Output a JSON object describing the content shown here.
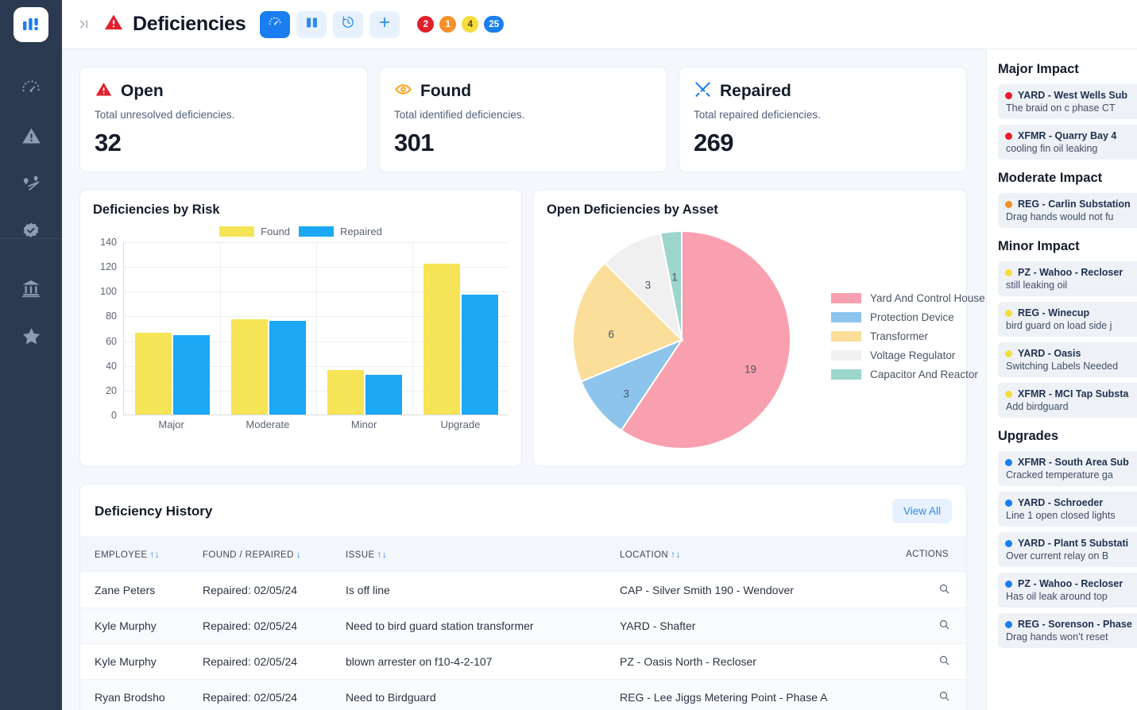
{
  "rail": {
    "logo": "app-logo",
    "items": [
      {
        "icon": "gauge-icon",
        "name": "dashboard"
      },
      {
        "icon": "warning-triangle-icon",
        "name": "deficiencies"
      },
      {
        "icon": "map-pin-route-icon",
        "name": "routes"
      },
      {
        "icon": "badge-check-icon",
        "name": "inspections"
      },
      {
        "icon": "bank-icon",
        "name": "substations"
      },
      {
        "icon": "star-icon",
        "name": "favorites"
      }
    ]
  },
  "topbar": {
    "collapse_label": "›|",
    "title": "Deficiencies",
    "title_icon": "warning-triangle-icon",
    "actions": [
      {
        "name": "dashboard-view",
        "icon": "gauge-icon",
        "active": true
      },
      {
        "name": "board-view",
        "icon": "columns-icon",
        "active": false
      },
      {
        "name": "history-view",
        "icon": "clock-rewind-icon",
        "active": false
      },
      {
        "name": "add-new",
        "icon": "plus-icon",
        "active": false
      }
    ],
    "badges": [
      {
        "value": "2",
        "color": "red"
      },
      {
        "value": "1",
        "color": "orange"
      },
      {
        "value": "4",
        "color": "yellow"
      },
      {
        "value": "25",
        "color": "blue"
      }
    ]
  },
  "stats": [
    {
      "icon": "warning-triangle-icon",
      "title": "Open",
      "subtitle": "Total unresolved deficiencies.",
      "value": "32"
    },
    {
      "icon": "eye-icon",
      "title": "Found",
      "subtitle": "Total identified deficiencies.",
      "value": "301"
    },
    {
      "icon": "tools-icon",
      "title": "Repaired",
      "subtitle": "Total repaired deficiencies.",
      "value": "269"
    }
  ],
  "chart_data": [
    {
      "type": "bar",
      "title": "Deficiencies by Risk",
      "categories": [
        "Major",
        "Moderate",
        "Minor",
        "Upgrade"
      ],
      "series": [
        {
          "name": "Found",
          "color": "#f5e455",
          "values": [
            66,
            77,
            36,
            122
          ]
        },
        {
          "name": "Repaired",
          "color": "#1ca8f5",
          "values": [
            64,
            76,
            32,
            97
          ]
        }
      ],
      "xlabel": "",
      "ylabel": "",
      "ylim": [
        0,
        140
      ],
      "yticks": [
        0,
        20,
        40,
        60,
        80,
        100,
        120,
        140
      ],
      "grid": true,
      "legend_position": "top"
    },
    {
      "type": "pie",
      "title": "Open Deficiencies by Asset",
      "labels": [
        "Yard And Control House",
        "Protection Device",
        "Transformer",
        "Voltage Regulator",
        "Capacitor And Reactor"
      ],
      "values": [
        19,
        3,
        6,
        3,
        1
      ],
      "colors": [
        "#f9a0b0",
        "#8cc4ec",
        "#fbde9a",
        "#f0f0f0",
        "#9bd5cc"
      ],
      "legend_position": "right"
    }
  ],
  "history": {
    "title": "Deficiency History",
    "view_all": "View All",
    "columns": [
      {
        "label": "EMPLOYEE",
        "sort": "both"
      },
      {
        "label": "FOUND / REPAIRED",
        "sort": "down"
      },
      {
        "label": "ISSUE",
        "sort": "both"
      },
      {
        "label": "LOCATION",
        "sort": "both"
      },
      {
        "label": "ACTIONS",
        "sort": "none"
      }
    ],
    "rows": [
      {
        "employee": "Zane Peters",
        "found_repaired": "Repaired: 02/05/24",
        "issue": "Is off line",
        "location": "CAP - Silver Smith 190 - Wendover",
        "action_icon": "search-icon"
      },
      {
        "employee": "Kyle Murphy",
        "found_repaired": "Repaired: 02/05/24",
        "issue": "Need to bird guard station transformer",
        "location": "YARD - Shafter",
        "action_icon": "search-icon"
      },
      {
        "employee": "Kyle Murphy",
        "found_repaired": "Repaired: 02/05/24",
        "issue": "blown arrester on f10-4-2-107",
        "location": "PZ - Oasis North - Recloser",
        "action_icon": "search-icon"
      },
      {
        "employee": "Ryan Brodsho",
        "found_repaired": "Repaired: 02/05/24",
        "issue": "Need to Birdguard",
        "location": "REG - Lee Jiggs Metering Point - Phase A",
        "action_icon": "search-icon"
      }
    ]
  },
  "right_panel": {
    "groups": [
      {
        "title": "Major Impact",
        "dot_color": "#ee1c2e",
        "items": [
          {
            "name": "YARD - West Wells Sub",
            "desc": "The braid on c phase CT"
          },
          {
            "name": "XFMR - Quarry Bay 4",
            "desc": "cooling fin oil leaking"
          }
        ]
      },
      {
        "title": "Moderate Impact",
        "dot_color": "#f5902a",
        "items": [
          {
            "name": "REG - Carlin Substation",
            "desc": "Drag hands would not fu"
          }
        ]
      },
      {
        "title": "Minor Impact",
        "dot_color": "#f5dd3c",
        "items": [
          {
            "name": "PZ - Wahoo - Recloser",
            "desc": "still leaking oil"
          },
          {
            "name": "REG - Winecup",
            "desc": "bird guard on load side j"
          },
          {
            "name": "YARD - Oasis",
            "desc": "Switching Labels Needed"
          },
          {
            "name": "XFMR - MCI Tap Substa",
            "desc": "Add birdguard"
          }
        ]
      },
      {
        "title": "Upgrades",
        "dot_color": "#1a7ef0",
        "items": [
          {
            "name": "XFMR - South Area Sub",
            "desc": "Cracked temperature ga"
          },
          {
            "name": "YARD - Schroeder",
            "desc": "Line 1 open closed lights"
          },
          {
            "name": "YARD - Plant 5 Substati",
            "desc": "Over current relay on B"
          },
          {
            "name": "PZ - Wahoo - Recloser",
            "desc": "Has oil leak around top"
          },
          {
            "name": "REG - Sorenson - Phase",
            "desc": "Drag hands won’t reset"
          }
        ]
      }
    ]
  }
}
